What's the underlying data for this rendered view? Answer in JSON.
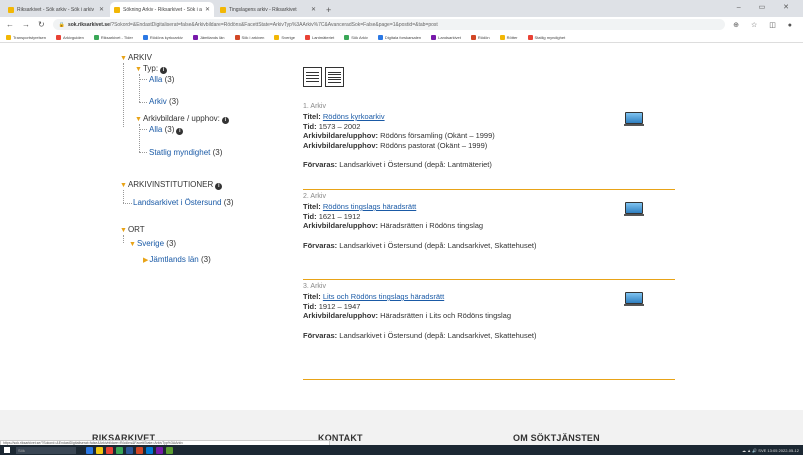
{
  "browser": {
    "tabs": [
      {
        "label": "Riksarkivet - Sök arkiv - Sök i arkiv",
        "active": false
      },
      {
        "label": "Sökning Arkiv - Riksarkivet - Sök i arkiv",
        "active": true
      },
      {
        "label": "Tingslagens arkiv - Riksarkivet",
        "active": false
      }
    ],
    "new_tab": "+",
    "window_controls": "– ▭ ✕",
    "url_host": "sok.riksarkivet.se",
    "url_rest": "/?Sokord=&EndastDigitaliserat=false&Arkivbildare=Rödöns&FacettState=ArkivTyp%3AArkiv%7C&AvanceradSok=False&page=1&postid=&tab=post",
    "toolbar_icons": "⊕ ☆ ◫ ●",
    "bookmarks": [
      "Transportstyrelsen",
      "Arkivguiden",
      "Riksarkivet - Tider",
      "Rödöns kyrkoarkiv",
      "Jämtlands län",
      "Sök i arkiven",
      "Sverige",
      "Lantmäteriet",
      "Sök Arkiv",
      "Digitala forskarsalen",
      "Landsarkivet",
      "Rödön",
      "Rötter",
      "Statlig myndighet"
    ]
  },
  "facets": {
    "arkiv": "ARKIV",
    "typ": "Typ:",
    "alla1": "Alla",
    "alla1_count": "(3)",
    "arkiv_item": "Arkiv",
    "arkiv_count": "(3)",
    "arkivbildare": "Arkivbildare / upphov:",
    "alla2": "Alla",
    "alla2_count": "(3)",
    "statlig": "Statlig myndighet",
    "statlig_count": "(3)",
    "arkivinst": "ARKIVINSTITUTIONER",
    "landsarkivet": "Landsarkivet i Östersund",
    "landsarkivet_count": "(3)",
    "ort": "ORT",
    "sverige": "Sverige",
    "sverige_count": "(3)",
    "jamtland": "Jämtlands län",
    "jamtland_count": "(3)"
  },
  "results": [
    {
      "num": "1. Arkiv",
      "titel_label": "Titel:",
      "titel": "Rödöns kyrkoarkiv",
      "tid_label": "Tid:",
      "tid": "1573 – 2002",
      "ab_label": "Arkivbildare/upphov:",
      "ab": "Rödöns församling (Okänt – 1999)",
      "ab2_label": "Arkivbildare/upphov:",
      "ab2": "Rödöns pastorat (Okänt – 1999)",
      "forvaras_label": "Förvaras:",
      "forvaras": "Landsarkivet i Östersund (depå: Lantmäteriet)"
    },
    {
      "num": "2. Arkiv",
      "titel_label": "Titel:",
      "titel": "Rödöns tingslags häradsrätt",
      "tid_label": "Tid:",
      "tid": "1621 – 1912",
      "ab_label": "Arkivbildare/upphov:",
      "ab": "Häradsrätten i Rödöns tingslag",
      "forvaras_label": "Förvaras:",
      "forvaras": "Landsarkivet i Östersund (depå: Landsarkivet, Skattehuset)"
    },
    {
      "num": "3. Arkiv",
      "titel_label": "Titel:",
      "titel": "Lits och Rödöns tingslags häradsrätt",
      "tid_label": "Tid:",
      "tid": "1912 – 1947",
      "ab_label": "Arkivbildare/upphov:",
      "ab": "Häradsrätten i Lits och Rödöns tingslag",
      "forvaras_label": "Förvaras:",
      "forvaras": "Landsarkivet i Östersund (depå: Landsarkivet, Skattehuset)"
    }
  ],
  "footer": {
    "riksarkivet": "RIKSARKIVET",
    "kontakt": "KONTAKT",
    "om": "OM SÖKTJÄNSTEN"
  },
  "status_url": "https://sok.riksarkivet.se/?Sokord=&EndastDigitaliserat=false&Arkivbildare=Rödöns&FacettState=ArkivTyp%3AArkiv",
  "taskbar": {
    "search": "Sök",
    "tray": "☁ ▲ 🔊 SVE 13:05 2022-05-12"
  },
  "colors": {
    "accent": "#e8a317",
    "link": "#1a5aa6",
    "footer_bg": "#f2f2f2"
  }
}
